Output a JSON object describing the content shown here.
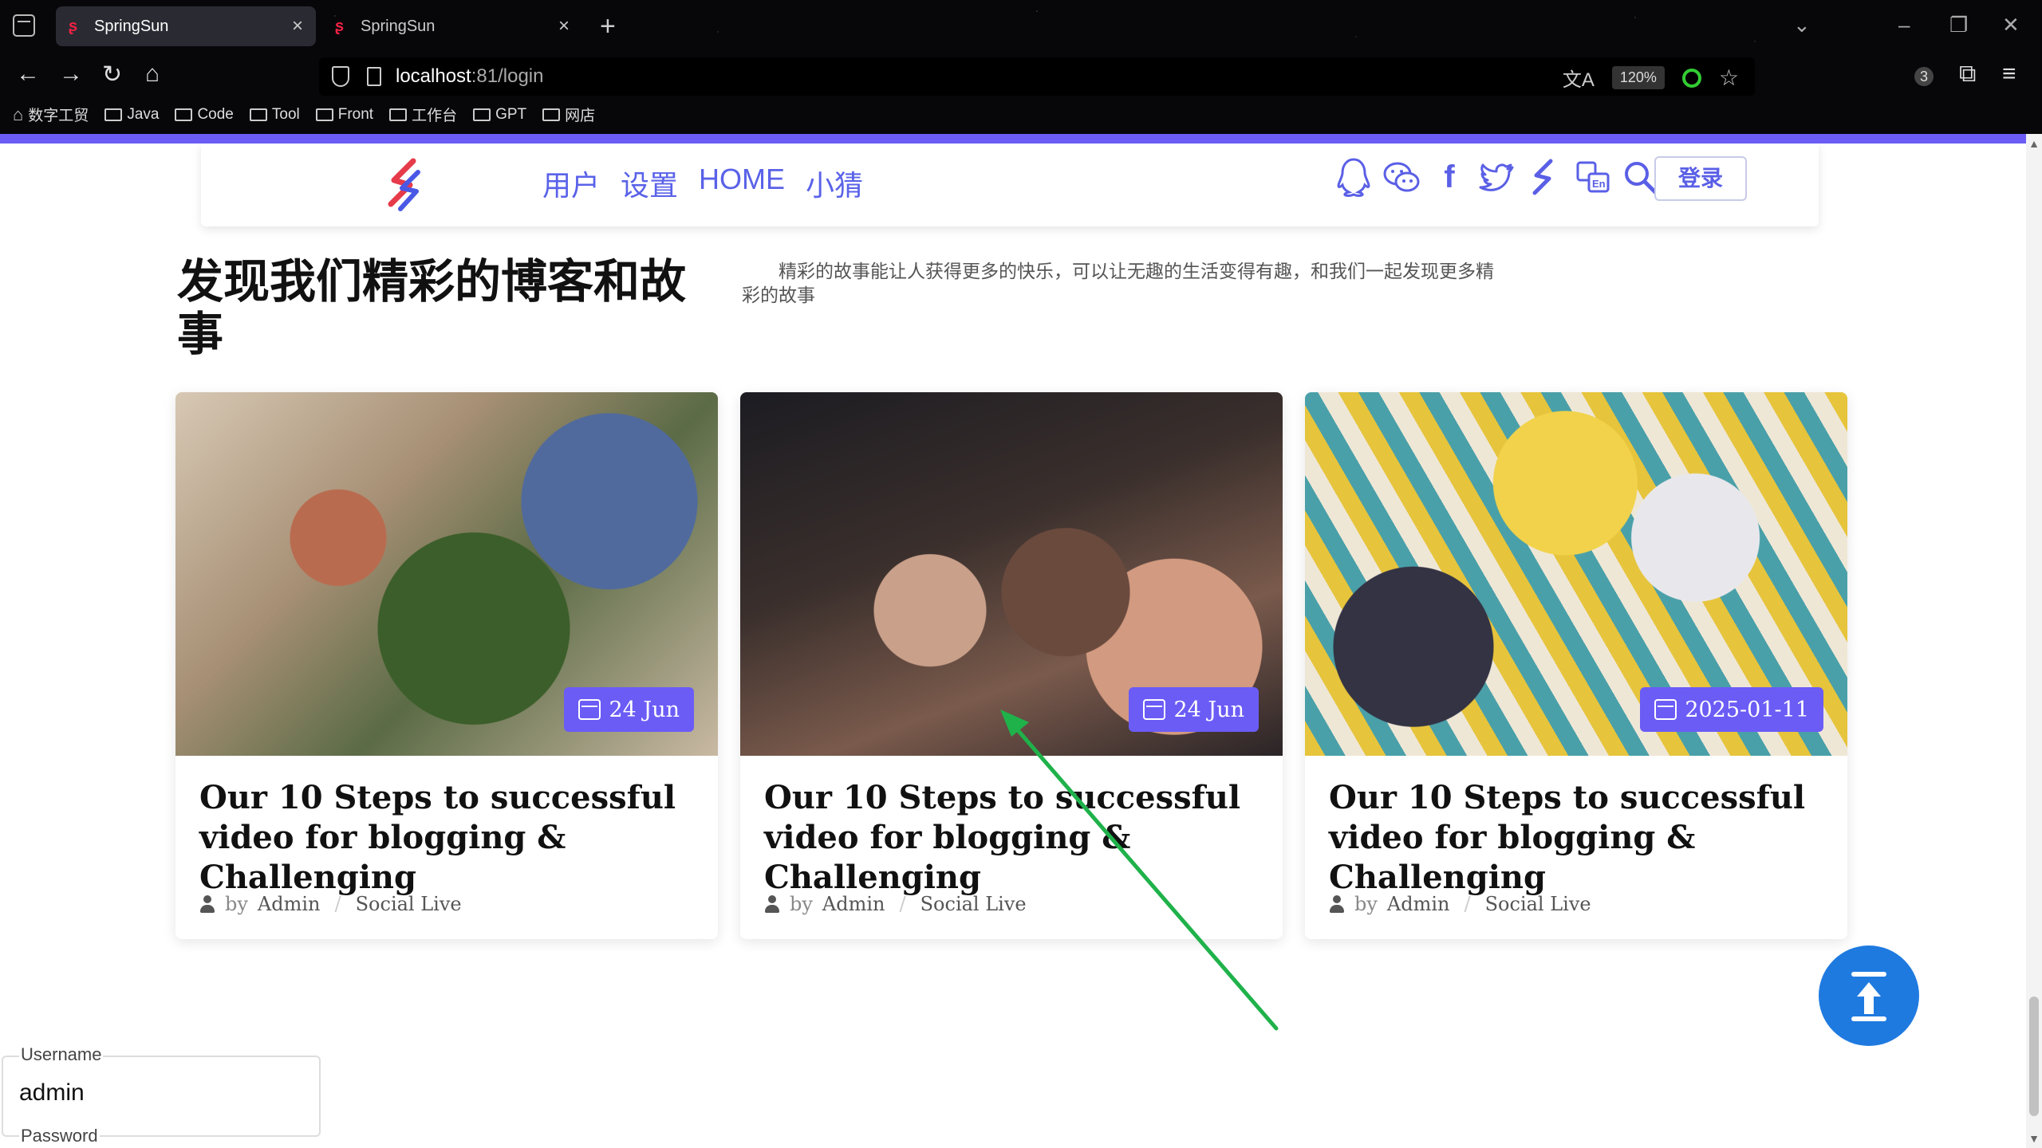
{
  "browser": {
    "tabs": [
      {
        "title": "SpringSun",
        "active": true
      },
      {
        "title": "SpringSun",
        "active": false
      }
    ],
    "url": {
      "host": "localhost",
      "path": ":81/login"
    },
    "zoom": "120%",
    "extensions_badge": "3",
    "bookmarks": [
      {
        "label": "数字工贸",
        "icon": "home-icon"
      },
      {
        "label": "Java",
        "icon": "folder-icon"
      },
      {
        "label": "Code",
        "icon": "folder-icon"
      },
      {
        "label": "Tool",
        "icon": "folder-icon"
      },
      {
        "label": "Front",
        "icon": "folder-icon"
      },
      {
        "label": "工作台",
        "icon": "folder-icon"
      },
      {
        "label": "GPT",
        "icon": "folder-icon"
      },
      {
        "label": "网店",
        "icon": "folder-icon"
      }
    ]
  },
  "header": {
    "nav": [
      "用户",
      "设置",
      "HOME",
      "小猜"
    ],
    "social_icons": [
      "qq-icon",
      "wechat-icon",
      "facebook-icon",
      "twitter-icon",
      "brand-logo-icon",
      "language-icon",
      "search-icon"
    ],
    "login_label": "登录"
  },
  "hero": {
    "title": "发现我们精彩的博客和故事",
    "description": "精彩的故事能让人获得更多的快乐，可以让无趣的生活变得有趣，和我们一起发现更多精彩的故事"
  },
  "cards": [
    {
      "date": "24 Jun",
      "title": "Our 10 Steps to successful video for blogging & Challenging",
      "by": "by",
      "author": "Admin",
      "separator": "/",
      "category": "Social Live"
    },
    {
      "date": "24 Jun",
      "title": "Our 10 Steps to successful video for blogging & Challenging",
      "by": "by",
      "author": "Admin",
      "separator": "/",
      "category": "Social Live"
    },
    {
      "date": "2025-01-11",
      "title": "Our 10 Steps to successful video for blogging & Challenging",
      "by": "by",
      "author": "Admin",
      "separator": "/",
      "category": "Social Live"
    }
  ],
  "login_form": {
    "username_label": "Username",
    "username_value": "admin",
    "password_label": "Password"
  },
  "colors": {
    "accent": "#6b5cf6",
    "nav_text": "#5a62e8",
    "top_button": "#1f7ae0",
    "annotation_arrow": "#1fb24a"
  }
}
